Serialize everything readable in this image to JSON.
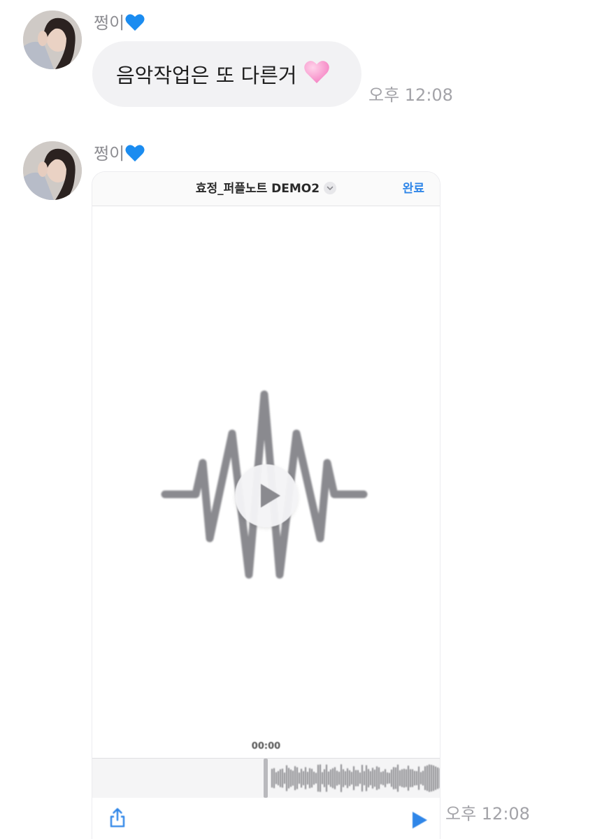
{
  "messages": [
    {
      "sender": "쩡이",
      "sender_heart_icon": "blue-heart-icon",
      "text": "음악작업은 또 다른거",
      "text_emoji_icon": "pink-heart-icon",
      "time": "오후 12:08"
    },
    {
      "sender": "쩡이",
      "sender_heart_icon": "blue-heart-icon",
      "attachment": {
        "title": "효정_퍼플노트 DEMO2",
        "done_label": "완료",
        "elapsed": "00:00",
        "icons": [
          "chevron-down-icon",
          "waveform-icon",
          "play-icon",
          "share-icon",
          "play-small-icon"
        ]
      },
      "time": "오후 12:08"
    }
  ],
  "colors": {
    "bubble": "#f2f2f4",
    "accent": "#2f86e8",
    "muted_text": "#a3a3a8",
    "waveform": "#8a8a8f"
  }
}
